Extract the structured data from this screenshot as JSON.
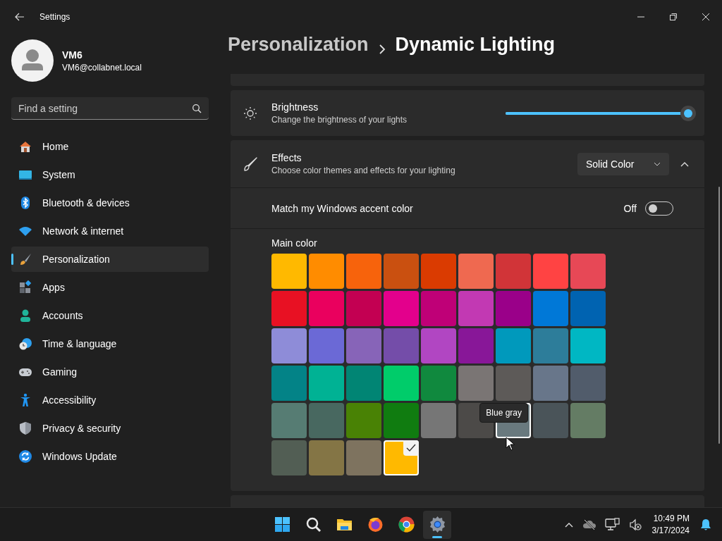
{
  "window": {
    "title": "Settings"
  },
  "profile": {
    "name": "VM6",
    "email": "VM6@collabnet.local"
  },
  "search": {
    "placeholder": "Find a setting"
  },
  "nav": [
    {
      "label": "Home",
      "selected": false
    },
    {
      "label": "System",
      "selected": false
    },
    {
      "label": "Bluetooth & devices",
      "selected": false
    },
    {
      "label": "Network & internet",
      "selected": false
    },
    {
      "label": "Personalization",
      "selected": true
    },
    {
      "label": "Apps",
      "selected": false
    },
    {
      "label": "Accounts",
      "selected": false
    },
    {
      "label": "Time & language",
      "selected": false
    },
    {
      "label": "Gaming",
      "selected": false
    },
    {
      "label": "Accessibility",
      "selected": false
    },
    {
      "label": "Privacy & security",
      "selected": false
    },
    {
      "label": "Windows Update",
      "selected": false
    }
  ],
  "breadcrumb": {
    "parent": "Personalization",
    "current": "Dynamic Lighting"
  },
  "brightness": {
    "title": "Brightness",
    "description": "Change the brightness of your lights",
    "level": 1.0
  },
  "effects": {
    "title": "Effects",
    "description": "Choose color themes and effects for your lighting",
    "dropdown": "Solid Color",
    "expanded": true,
    "accent_match": {
      "label": "Match my Windows accent color",
      "state_text": "Off",
      "on": false
    },
    "main_color": {
      "label": "Main color",
      "swatches": [
        {
          "color": "#ffb900",
          "selected": false,
          "hovered": false
        },
        {
          "color": "#ff8c00",
          "selected": false,
          "hovered": false
        },
        {
          "color": "#f7630c",
          "selected": false,
          "hovered": false
        },
        {
          "color": "#ca5010",
          "selected": false,
          "hovered": false
        },
        {
          "color": "#da3b01",
          "selected": false,
          "hovered": false
        },
        {
          "color": "#ef6950",
          "selected": false,
          "hovered": false
        },
        {
          "color": "#d13438",
          "selected": false,
          "hovered": false
        },
        {
          "color": "#ff4343",
          "selected": false,
          "hovered": false
        },
        {
          "color": "#e74856",
          "selected": false,
          "hovered": false
        },
        {
          "color": "#e81123",
          "selected": false,
          "hovered": false
        },
        {
          "color": "#ea005e",
          "selected": false,
          "hovered": false
        },
        {
          "color": "#c30052",
          "selected": false,
          "hovered": false
        },
        {
          "color": "#e3008c",
          "selected": false,
          "hovered": false
        },
        {
          "color": "#bf0077",
          "selected": false,
          "hovered": false
        },
        {
          "color": "#c239b3",
          "selected": false,
          "hovered": false
        },
        {
          "color": "#9a0089",
          "selected": false,
          "hovered": false
        },
        {
          "color": "#0078d7",
          "selected": false,
          "hovered": false
        },
        {
          "color": "#0063b1",
          "selected": false,
          "hovered": false
        },
        {
          "color": "#8e8cd8",
          "selected": false,
          "hovered": false
        },
        {
          "color": "#6b69d6",
          "selected": false,
          "hovered": false
        },
        {
          "color": "#8764b8",
          "selected": false,
          "hovered": false
        },
        {
          "color": "#744da9",
          "selected": false,
          "hovered": false
        },
        {
          "color": "#b146c2",
          "selected": false,
          "hovered": false
        },
        {
          "color": "#881798",
          "selected": false,
          "hovered": false
        },
        {
          "color": "#0099bc",
          "selected": false,
          "hovered": false
        },
        {
          "color": "#2d7d9a",
          "selected": false,
          "hovered": false
        },
        {
          "color": "#00b7c3",
          "selected": false,
          "hovered": false
        },
        {
          "color": "#038387",
          "selected": false,
          "hovered": false
        },
        {
          "color": "#00b294",
          "selected": false,
          "hovered": false
        },
        {
          "color": "#018574",
          "selected": false,
          "hovered": false
        },
        {
          "color": "#00cc6a",
          "selected": false,
          "hovered": false
        },
        {
          "color": "#10893e",
          "selected": false,
          "hovered": false
        },
        {
          "color": "#7a7574",
          "selected": false,
          "hovered": false
        },
        {
          "color": "#5d5a58",
          "selected": false,
          "hovered": false
        },
        {
          "color": "#68768a",
          "selected": false,
          "hovered": false
        },
        {
          "color": "#515c6b",
          "selected": false,
          "hovered": false
        },
        {
          "color": "#567c73",
          "selected": false,
          "hovered": false
        },
        {
          "color": "#486860",
          "selected": false,
          "hovered": false
        },
        {
          "color": "#498205",
          "selected": false,
          "hovered": false
        },
        {
          "color": "#107c10",
          "selected": false,
          "hovered": false
        },
        {
          "color": "#767676",
          "selected": false,
          "hovered": false
        },
        {
          "color": "#4c4a48",
          "selected": false,
          "hovered": false
        },
        {
          "color": "#69797e",
          "selected": false,
          "hovered": true,
          "tooltip": "Blue gray"
        },
        {
          "color": "#4a5459",
          "selected": false,
          "hovered": false
        },
        {
          "color": "#647c64",
          "selected": false,
          "hovered": false
        },
        {
          "color": "#525e54",
          "selected": false,
          "hovered": false
        },
        {
          "color": "#847545",
          "selected": false,
          "hovered": false
        },
        {
          "color": "#7e735f",
          "selected": false,
          "hovered": false
        },
        {
          "color": "#ffb900",
          "selected": true,
          "hovered": false
        }
      ]
    }
  },
  "taskbar": {
    "apps": [
      {
        "active": false
      },
      {
        "active": false
      },
      {
        "active": false
      },
      {
        "active": false
      },
      {
        "active": false
      },
      {
        "active": true
      }
    ],
    "time": "10:49 PM",
    "date": "3/17/2024"
  }
}
